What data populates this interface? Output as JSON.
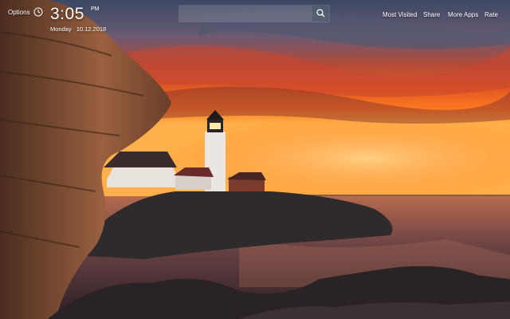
{
  "header": {
    "options_label": "Options",
    "time": "3:05",
    "ampm": "PM",
    "day": "Monday",
    "date": "10.12.2018"
  },
  "search": {
    "placeholder": ""
  },
  "nav": {
    "most_visited": "Most Visited",
    "share": "Share",
    "more_apps": "More Apps",
    "rate": "Rate"
  },
  "colors": {
    "sky_top": "#3a4a63",
    "sunset_orange": "#ff6a1e",
    "horizon_glow": "#ffb347",
    "sea": "#3d2a2e",
    "rock": "#8a5a3a"
  },
  "icons": {
    "clock": "clock-icon",
    "search": "search-icon"
  }
}
